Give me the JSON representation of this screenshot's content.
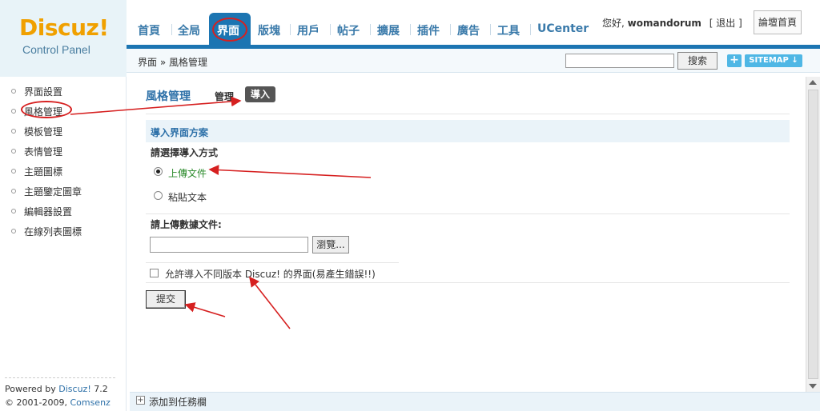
{
  "logo": {
    "brand": "Discuz!",
    "sub": "Control Panel"
  },
  "nav": {
    "items": [
      "首頁",
      "全局",
      "界面",
      "版塊",
      "用戶",
      "帖子",
      "擴展",
      "插件",
      "廣告",
      "工具",
      "UCenter"
    ],
    "active": "界面"
  },
  "user": {
    "greeting": "您好,",
    "name": "womandorum",
    "logout": "[ 退出 ]",
    "home": "論壇首頁"
  },
  "subbar": {
    "breadcrumb": "界面 » 風格管理",
    "search_label": "搜索",
    "plus": "+",
    "sitemap": "SITEMAP ↓"
  },
  "sidebar": {
    "items": [
      "界面設置",
      "風格管理",
      "模板管理",
      "表情管理",
      "主題圖標",
      "主題鑒定圖章",
      "編輯器設置",
      "在線列表圖標"
    ],
    "powered_prefix": "Powered by ",
    "powered_link": "Discuz!",
    "version": "7.2",
    "copyright_prefix": "© 2001-2009, ",
    "copyright_link": "Comsenz Inc."
  },
  "main": {
    "title": "風格管理",
    "tab_manage": "管理",
    "tab_import": "導入",
    "section": "導入界面方案",
    "choose_label": "請選擇導入方式",
    "option_upload": "上傳文件",
    "option_paste": "粘貼文本",
    "upload_label": "請上傳數據文件:",
    "browse": "瀏覽...",
    "allow_label": "允許導入不同版本 Discuz! 的界面(易產生錯誤!!)",
    "submit": "提交"
  },
  "footer": {
    "add_task": "添加到任務欄"
  },
  "colors": {
    "accent": "#1c75b2",
    "annotation": "#d62020",
    "logo": "#f0a000"
  }
}
